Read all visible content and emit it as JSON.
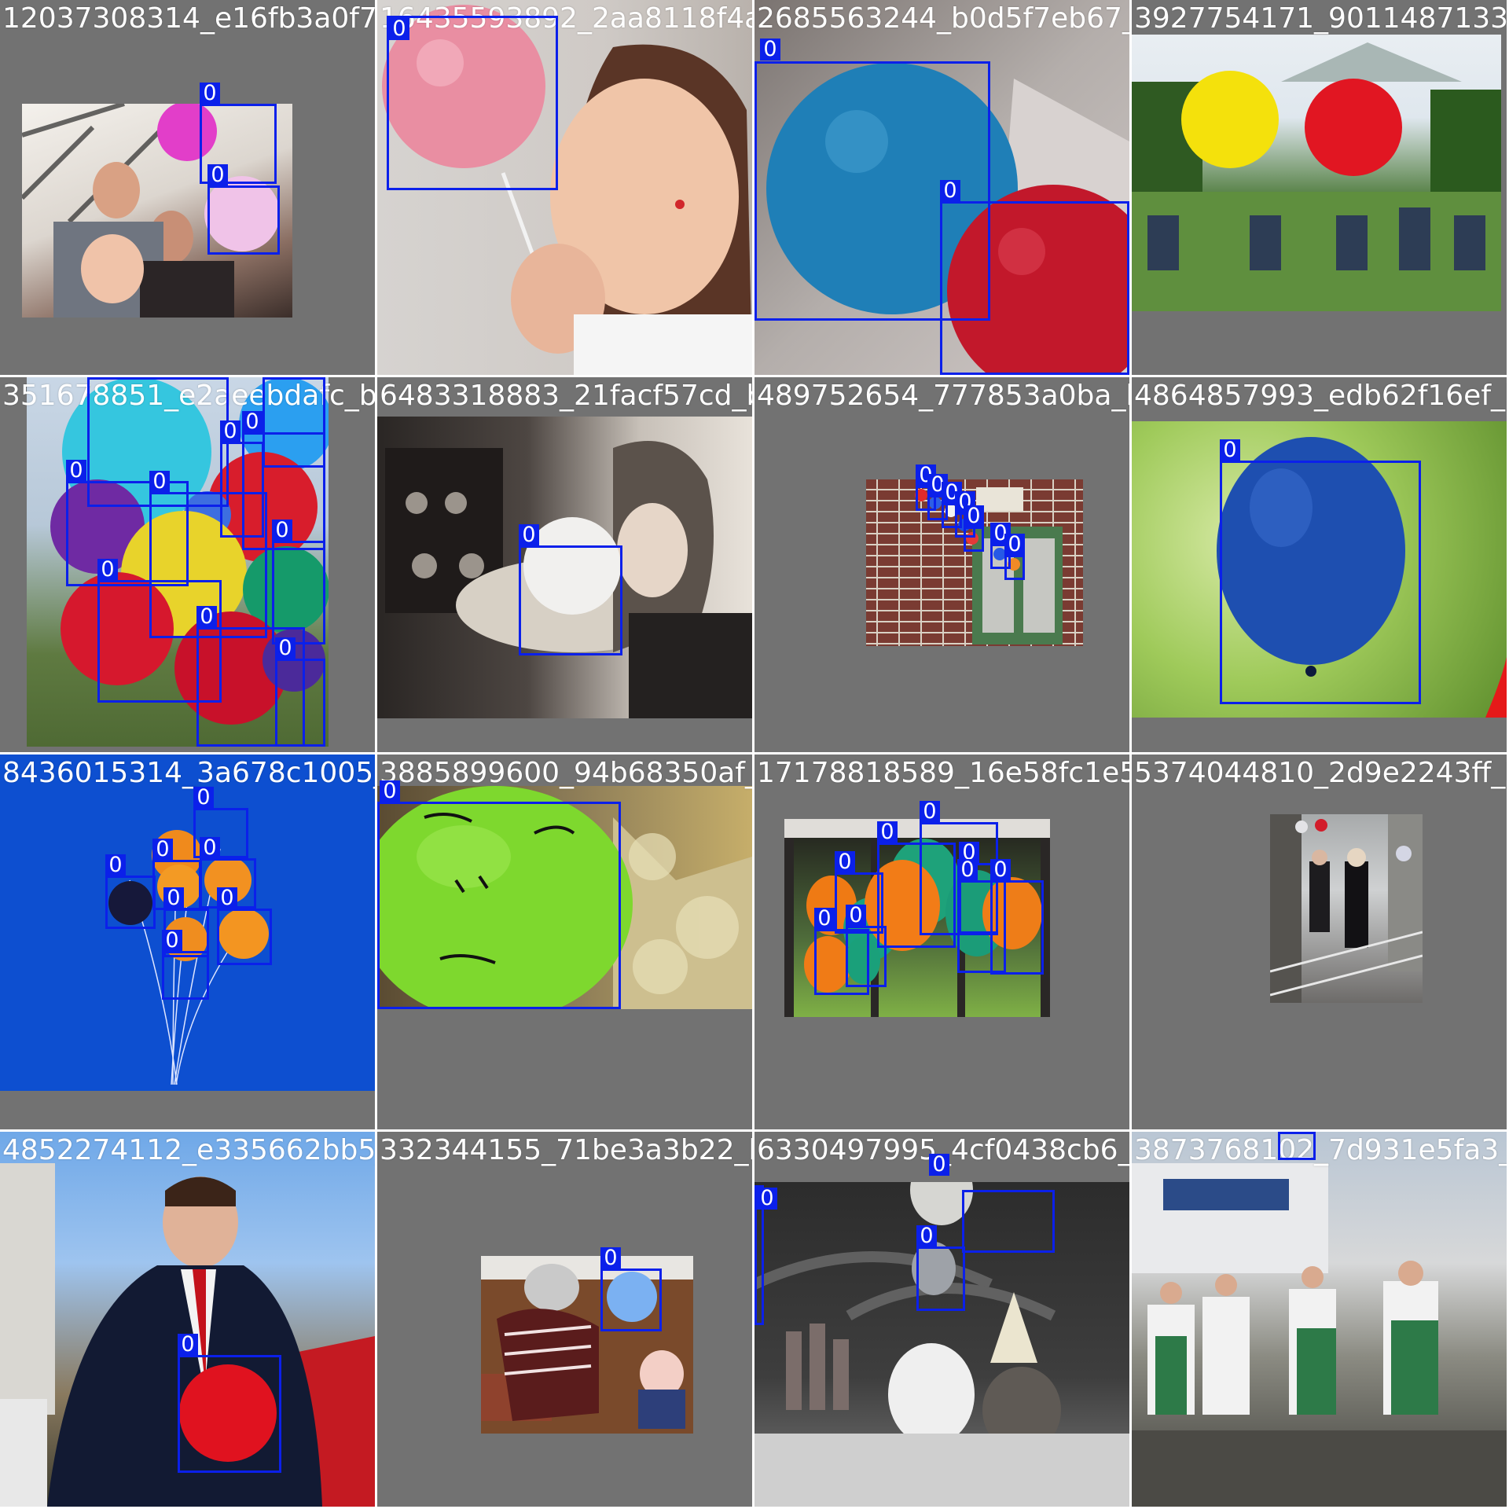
{
  "mosaic": {
    "box_color": "#0b20ea",
    "tiles": [
      {
        "filename": "12037308314_e16fb3a0f7_k.jpg",
        "background": "#727272",
        "boxes": [
          {
            "class_label": "0"
          },
          {
            "class_label": "0"
          }
        ]
      },
      {
        "filename": "16435593892_2aa8118f4a_k.jpg",
        "background": "#727272",
        "boxes": [
          {
            "class_label": "0"
          }
        ]
      },
      {
        "filename": "2685563244_b0d5f7eb67_b.jpg",
        "background": "#727272",
        "boxes": [
          {
            "class_label": "0"
          },
          {
            "class_label": "0"
          }
        ]
      },
      {
        "filename": "3927754171_9011487133_b.jpg",
        "background": "#727272",
        "boxes": []
      },
      {
        "filename": "351678851_e2aeebdafc_b.jpg",
        "background": "#727272",
        "boxes": [
          {
            "class_label": "0"
          },
          {
            "class_label": "0"
          },
          {
            "class_label": "0"
          },
          {
            "class_label": "0"
          },
          {
            "class_label": "0"
          },
          {
            "class_label": "0"
          },
          {
            "class_label": "0"
          },
          {
            "class_label": "0"
          },
          {
            "class_label": "0"
          },
          {
            "class_label": "0"
          }
        ]
      },
      {
        "filename": "6483318883_21facf57cd_b.jpg",
        "background": "#727272",
        "boxes": [
          {
            "class_label": "0"
          }
        ]
      },
      {
        "filename": "489752654_777853a0ba_b.jpg",
        "background": "#727272",
        "boxes": [
          {
            "class_label": "0"
          },
          {
            "class_label": "0"
          },
          {
            "class_label": "0"
          },
          {
            "class_label": "0"
          },
          {
            "class_label": "0"
          },
          {
            "class_label": "0"
          },
          {
            "class_label": "0"
          }
        ]
      },
      {
        "filename": "4864857993_edb62f16ef_b.jpg",
        "background": "#727272",
        "boxes": [
          {
            "class_label": "0"
          }
        ]
      },
      {
        "filename": "8436015314_3a678c1005_k.jpg",
        "background": "#727272",
        "boxes": [
          {
            "class_label": "0"
          },
          {
            "class_label": "0"
          },
          {
            "class_label": "0"
          },
          {
            "class_label": "0"
          },
          {
            "class_label": "0"
          },
          {
            "class_label": "0"
          },
          {
            "class_label": "0"
          }
        ]
      },
      {
        "filename": "3885899600_94b68350af_b.jpg",
        "background": "#727272",
        "boxes": [
          {
            "class_label": "0"
          }
        ]
      },
      {
        "filename": "17178818589_16e58fc1e5_k.jpg",
        "background": "#727272",
        "boxes": [
          {
            "class_label": "0"
          },
          {
            "class_label": "0"
          },
          {
            "class_label": "0"
          },
          {
            "class_label": "0"
          },
          {
            "class_label": "0"
          },
          {
            "class_label": "0"
          },
          {
            "class_label": "0"
          },
          {
            "class_label": "0"
          }
        ]
      },
      {
        "filename": "5374044810_2d9e2243ff_b.jpg",
        "background": "#727272",
        "boxes": []
      },
      {
        "filename": "4852274112_e335662bb5_b.jpg",
        "background": "#727272",
        "boxes": [
          {
            "class_label": "0"
          }
        ]
      },
      {
        "filename": "332344155_71be3a3b22_b.jpg",
        "background": "#727272",
        "boxes": [
          {
            "class_label": "0"
          }
        ]
      },
      {
        "filename": "6330497995_4cf0438cb6_k.jpg",
        "background": "#727272",
        "boxes": [
          {
            "class_label": "0"
          },
          {
            "class_label": "0"
          },
          {
            "class_label": "0"
          }
        ]
      },
      {
        "filename": "3873768102_7d931e5fa3_b.jpg",
        "background": "#727272",
        "boxes": [
          {
            "class_label": "0"
          }
        ]
      }
    ]
  }
}
